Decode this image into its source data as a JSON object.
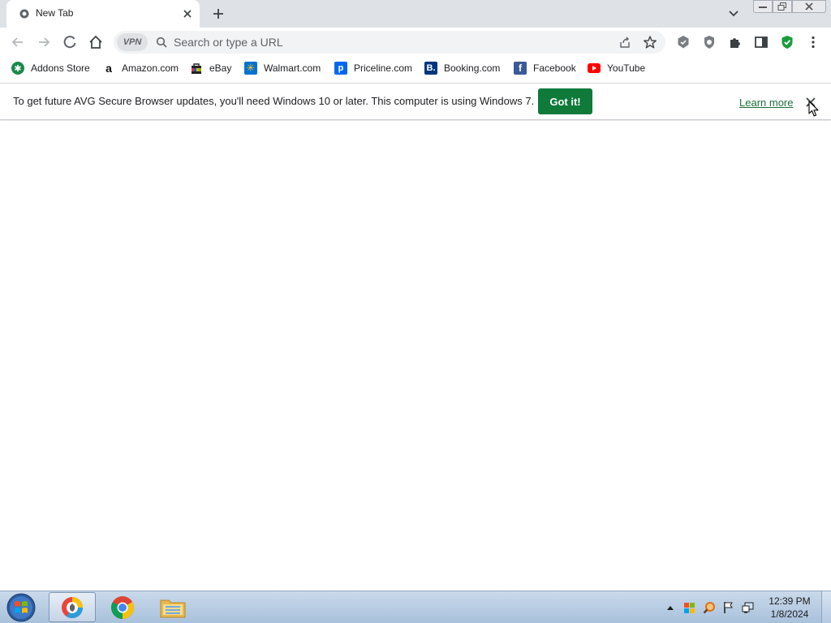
{
  "browser": {
    "tab": {
      "title": "New Tab"
    },
    "omnibox": {
      "vpn_label": "VPN",
      "placeholder": "Search or type a URL"
    }
  },
  "bookmarks": [
    {
      "label": "Addons Store",
      "icon": "addons-store-icon",
      "color": "#1a8a4a"
    },
    {
      "label": "Amazon.com",
      "icon": "amazon-icon",
      "color": "#ffffff"
    },
    {
      "label": "eBay",
      "icon": "ebay-icon",
      "color": "#e53238"
    },
    {
      "label": "Walmart.com",
      "icon": "walmart-icon",
      "color": "#0071ce"
    },
    {
      "label": "Priceline.com",
      "icon": "priceline-icon",
      "color": "#0068ef"
    },
    {
      "label": "Booking.com",
      "icon": "booking-icon",
      "color": "#003580"
    },
    {
      "label": "Facebook",
      "icon": "facebook-icon",
      "color": "#3b5998"
    },
    {
      "label": "YouTube",
      "icon": "youtube-icon",
      "color": "#ff0000"
    }
  ],
  "infobar": {
    "message": "To get future AVG Secure Browser updates, you'll need Windows 10 or later. This computer is using Windows 7.",
    "button": "Got it!",
    "link": "Learn more"
  },
  "taskbar": {
    "time": "12:39 PM",
    "date": "1/8/2024"
  },
  "colors": {
    "accent_green": "#0f7a3a",
    "tabstrip": "#dee1e6",
    "taskbar": "#b7cbe2"
  }
}
